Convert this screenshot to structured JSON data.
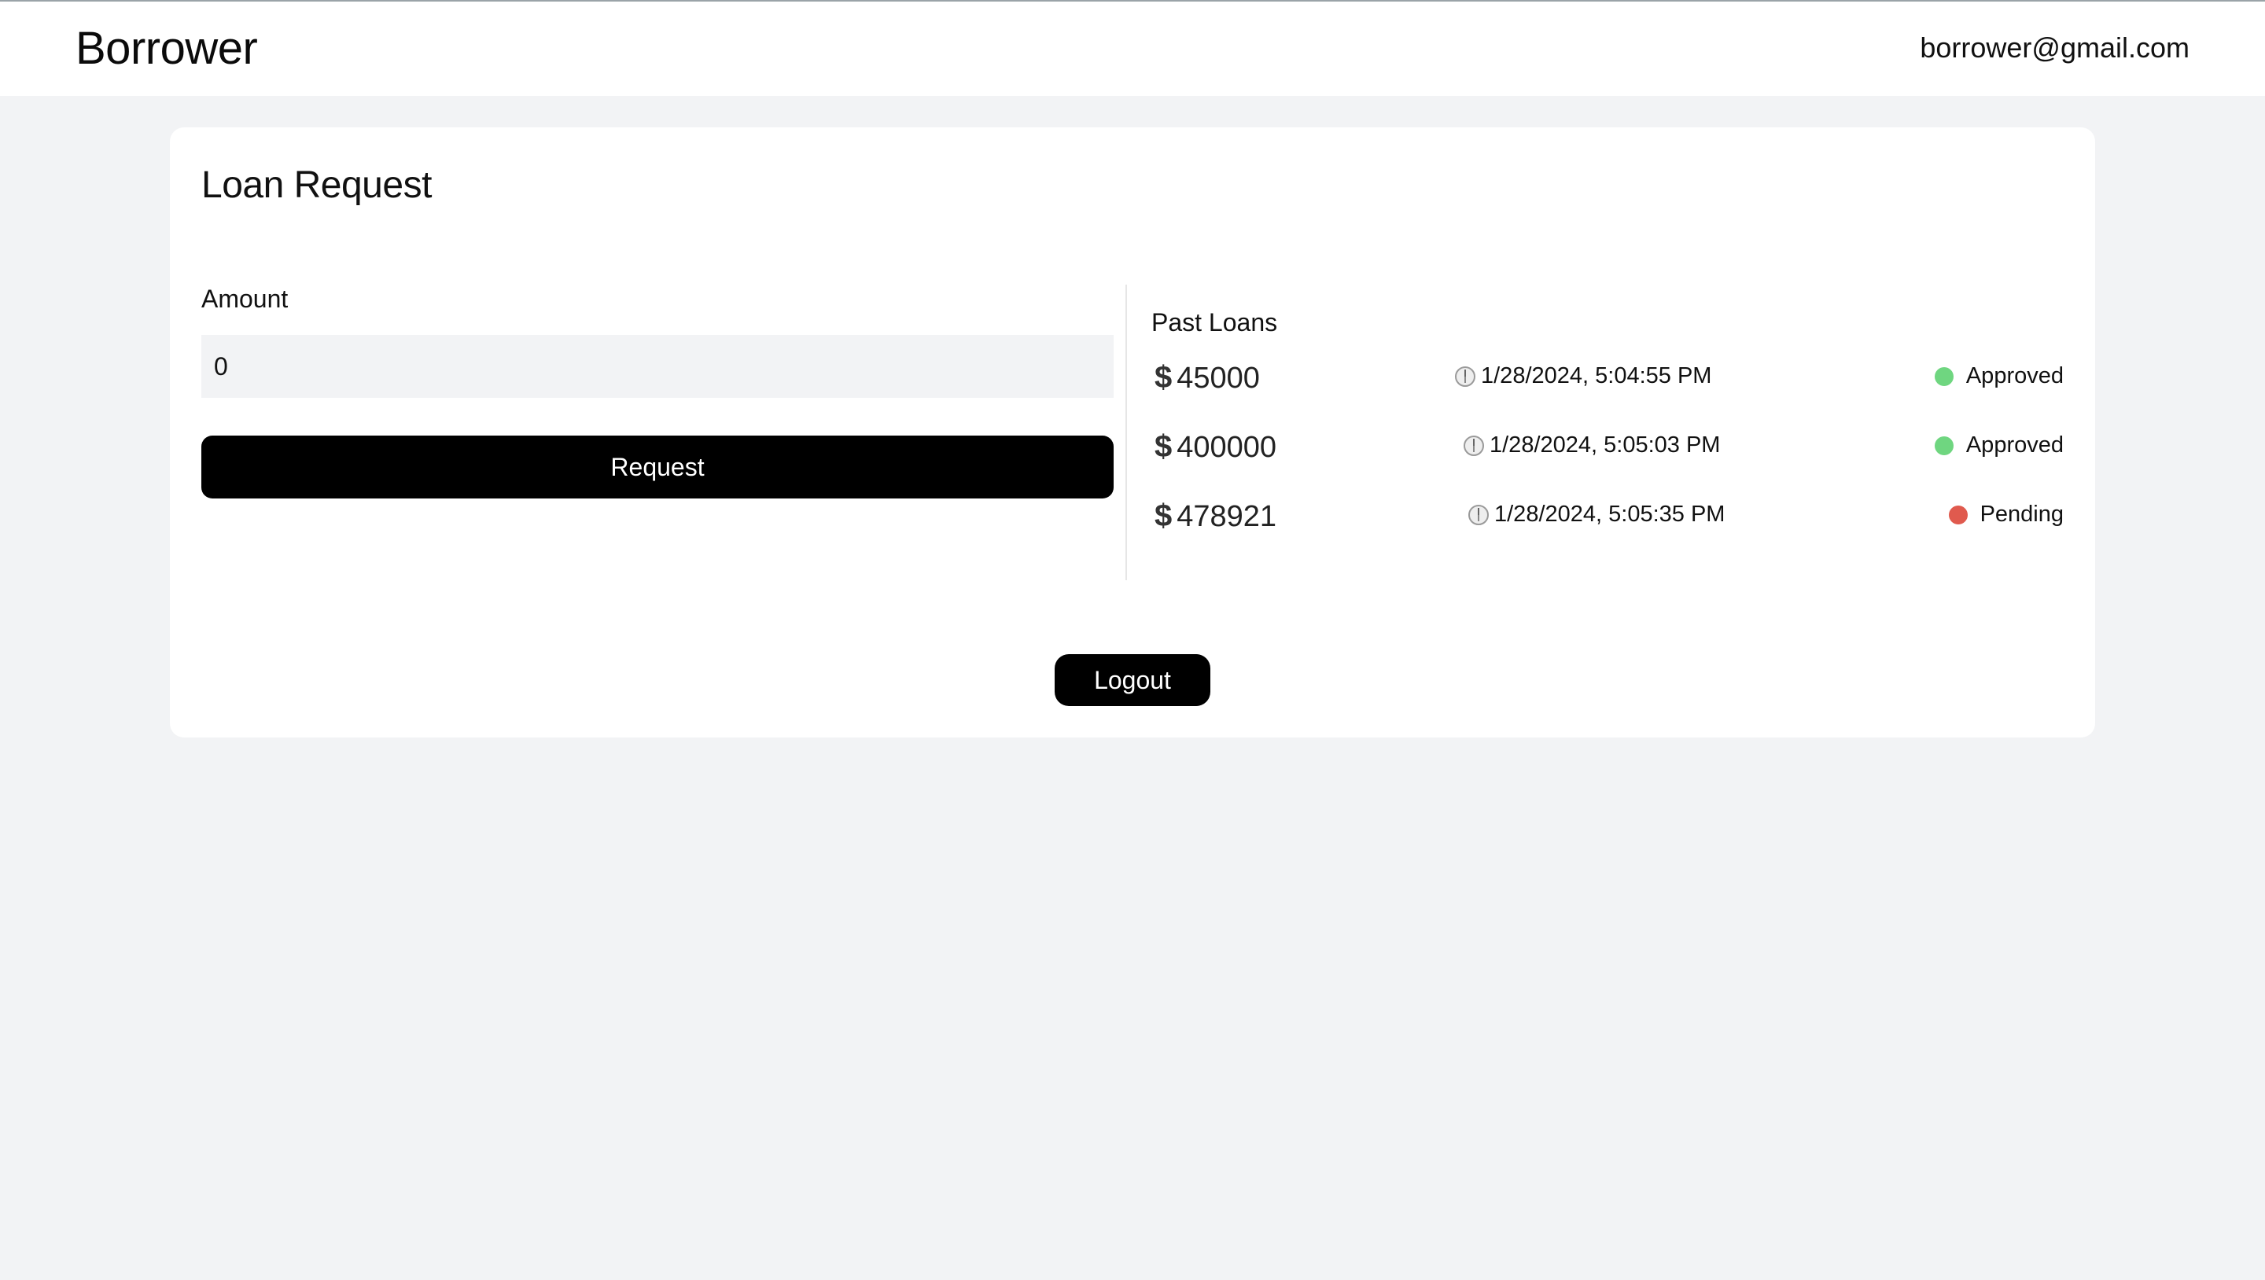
{
  "header": {
    "brand": "Borrower",
    "user_email": "borrower@gmail.com"
  },
  "card": {
    "title": "Loan Request"
  },
  "form": {
    "amount_label": "Amount",
    "amount_value": "0",
    "request_label": "Request"
  },
  "past_loans": {
    "title": "Past Loans",
    "currency_symbol": "$",
    "items": [
      {
        "amount": "45000",
        "date": "1/28/2024, 5:04:55 PM",
        "status": "Approved",
        "status_color": "#6fd680"
      },
      {
        "amount": "400000",
        "date": "1/28/2024, 5:05:03 PM",
        "status": "Approved",
        "status_color": "#6fd680"
      },
      {
        "amount": "478921",
        "date": "1/28/2024, 5:05:35 PM",
        "status": "Pending",
        "status_color": "#e05a4e"
      }
    ]
  },
  "actions": {
    "logout_label": "Logout"
  },
  "colors": {
    "background": "#f2f3f5",
    "surface": "#ffffff",
    "primary_button": "#000000",
    "approved": "#6fd680",
    "pending": "#e05a4e"
  }
}
